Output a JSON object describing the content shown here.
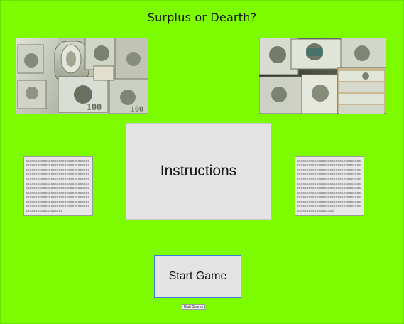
{
  "screen": {
    "title": "Surplus or Dearth?",
    "background_color": "#7dfc00"
  },
  "images": {
    "left": {
      "description_icon": "money-rolls-photo"
    },
    "right": {
      "description_icon": "money-stacks-photo"
    }
  },
  "pattern_boxes": {
    "left_text": "ssssssssssssssssssssssssssssssssssssssssssssssssssssssssssssssssssssssssssssssssssssssssssssssssssssssssssssssssssssssssssssssssssssssssssssssssssssssssssssssssssssssssssssssssssssssssssssssssssssssssssssssssssssssssssssssssssssssssssssssssssssssssssssssssssssssssssssssssssssssssssssssssssssssssssssssssssssssssssssssssssssssssssssssssssssssssssssssssssssssssssssssssssssssssssssss",
    "right_text": "ssssssssssssssssssssssssssssssssssssssssssssssssssssssssssssssssssssssssssssssssssssssssssssssssssssssssssssssssssssssssssssssssssssssssssssssssssssssssssssssssssssssssssssssssssssssssssssssssssssssssssssssssssssssssssssssssssssssssssssssssssssssssssssssssssssssssssssssssssssssssssssssssssssssssssssssssssssssssssssssssssssssssssssssssssssssssssssssssssssssssssssssssssssssssssssss"
  },
  "buttons": {
    "instructions_label": "Instructions",
    "start_label": "Start Game",
    "highscores_label": "High Scores"
  }
}
